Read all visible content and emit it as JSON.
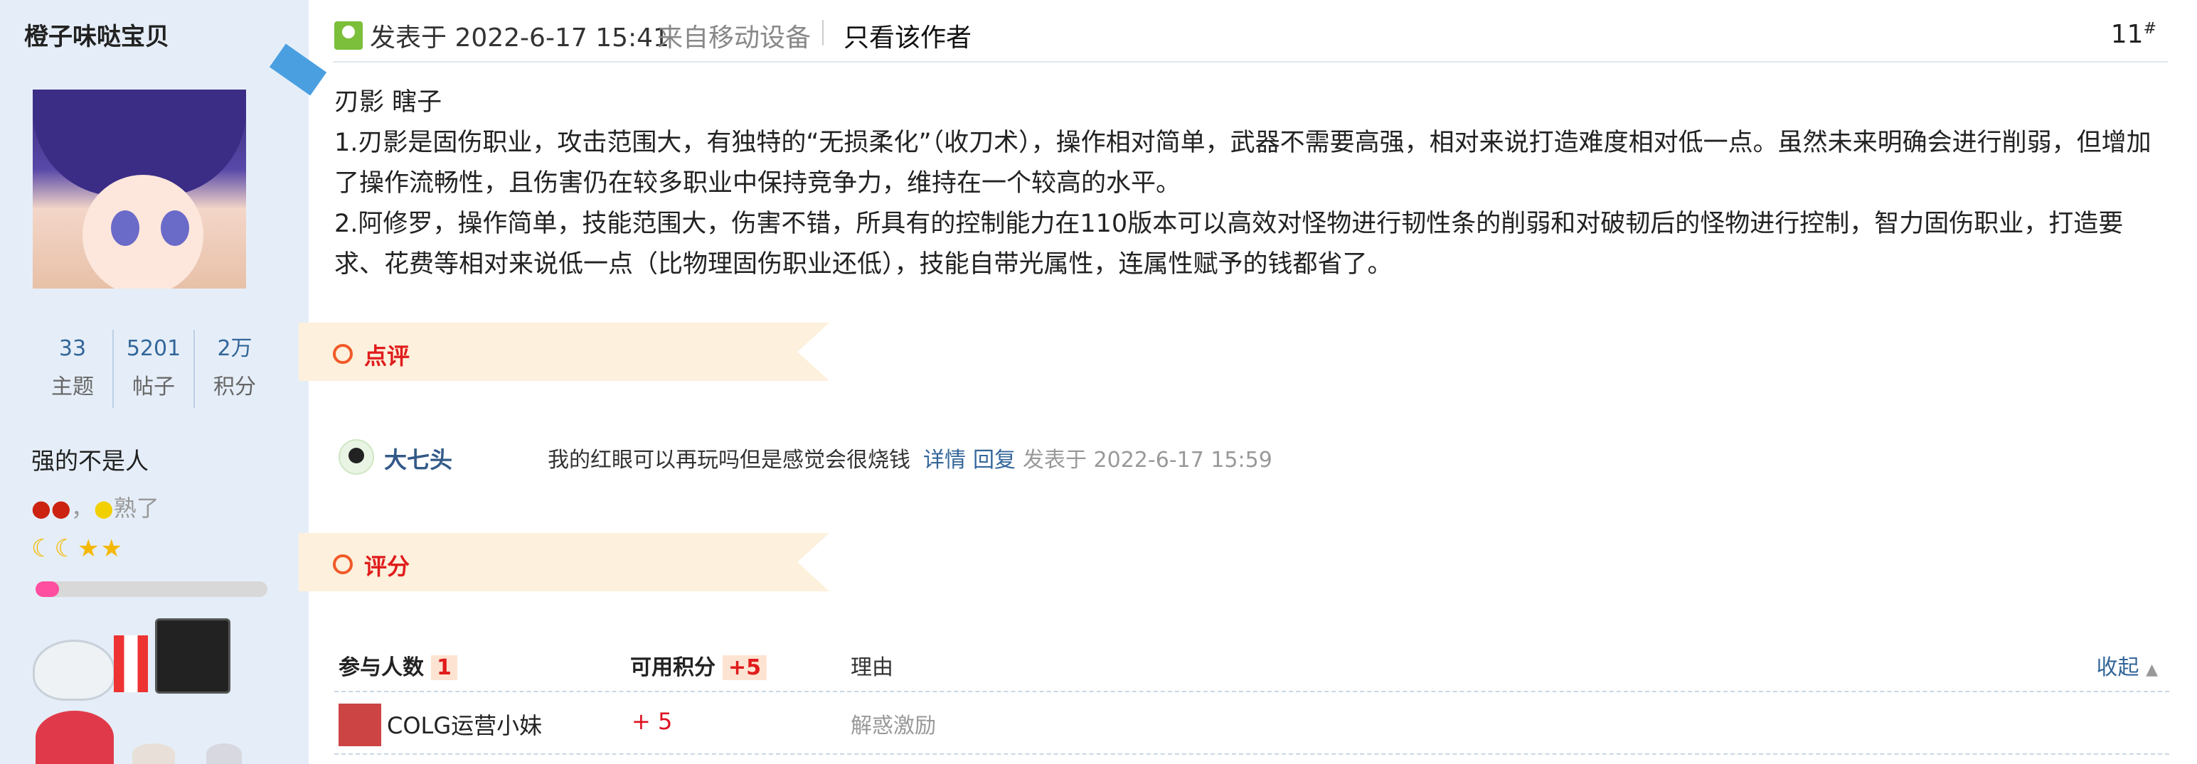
{
  "user": {
    "name": "橙子味哒宝贝",
    "stats": [
      {
        "value": "33",
        "label": "主题"
      },
      {
        "value": "5201",
        "label": "帖子"
      },
      {
        "value": "2万",
        "label": "积分"
      }
    ],
    "title": "强的不是人",
    "honor": "熟了",
    "level_progress": 0.1
  },
  "post": {
    "time": "发表于 2022-6-17 15:41",
    "device": "来自移动设备",
    "only_author": "只看该作者",
    "floor": "11",
    "floor_suffix": "#",
    "body": [
      "刃影 瞎子",
      "1.刃影是固伤职业，攻击范围大，有独特的“无损柔化”（收刀术），操作相对简单，武器不需要高强，相对来说打造难度相对低一点。虽然未来明确会进行削弱，但增加了操作流畅性，且伤害仍在较多职业中保持竞争力，维持在一个较高的水平。",
      "2.阿修罗，操作简单，技能范围大，伤害不错，所具有的控制能力在110版本可以高效对怪物进行韧性条的削弱和对破韧后的怪物进行控制，智力固伤职业，打造要求、花费等相对来说低一点（比物理固伤职业还低），技能自带光属性，连属性赋予的钱都省了。"
    ]
  },
  "review": {
    "section_label": "点评",
    "commenter": "大七头",
    "comment": "我的红眼可以再玩吗但是感觉会很烧钱",
    "detail_link": "详情",
    "reply_link": "回复",
    "comment_time": "发表于 2022-6-17 15:59"
  },
  "rating": {
    "section_label": "评分",
    "participants_label": "参与人数",
    "participants_count": "1",
    "points_label": "可用积分",
    "points_total": "+5",
    "reason_label": "理由",
    "collapse_label": "收起",
    "rows": [
      {
        "name": "COLG运营小妹",
        "score": "+ 5",
        "reason": "解惑激励"
      }
    ]
  }
}
